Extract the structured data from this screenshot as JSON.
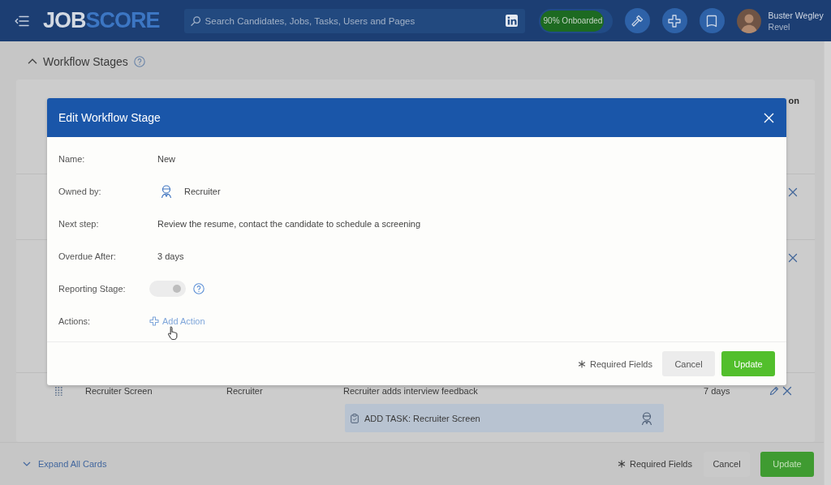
{
  "header": {
    "logo": {
      "part_1": "JOB",
      "part_2": "SCORE"
    },
    "search": {
      "placeholder": "Search Candidates, Jobs, Tasks, Users and Pages"
    },
    "onboarding": {
      "label": "90% Onboarded",
      "level": 0.9
    },
    "user": {
      "name": "Buster Wegley",
      "company": "Revel"
    }
  },
  "section": {
    "title": "Workflow Stages",
    "expanded": true
  },
  "table": {
    "last_column_heading": "on",
    "rows": [
      {
        "kind": "covered"
      },
      {
        "kind": "covered"
      },
      {
        "kind": "stage",
        "name": "Recruiter Screen",
        "owner": "Recruiter",
        "next_step": "Recruiter adds interview feedback",
        "overdue_after": "7 days",
        "tasks": [
          {
            "label": "ADD TASK: Recruiter Screen"
          }
        ]
      }
    ]
  },
  "footer": {
    "expand_all": "Expand All Cards",
    "required_note": "Required Fields",
    "buttons": [
      {
        "label": "Cancel",
        "kind": "secondary"
      },
      {
        "label": "Update",
        "kind": "primary"
      }
    ]
  },
  "modal": {
    "title": "Edit Workflow Stage",
    "fields": [
      {
        "kind": "text",
        "label": "Name:",
        "value": "New"
      },
      {
        "kind": "owner",
        "label": "Owned by:",
        "value": "Recruiter"
      },
      {
        "kind": "text",
        "label": "Next step:",
        "value": "Review the resume, contact the candidate to schedule a screening"
      },
      {
        "kind": "text",
        "label": "Overdue After:",
        "value": "3 days"
      },
      {
        "kind": "toggle",
        "label": "Reporting Stage:",
        "on": true,
        "disabled": true
      },
      {
        "kind": "link",
        "label": "Actions:",
        "value": "Add Action"
      }
    ],
    "required_note": "Required Fields",
    "buttons": [
      {
        "label": "Cancel",
        "kind": "secondary"
      },
      {
        "label": "Update",
        "kind": "primary"
      }
    ]
  }
}
